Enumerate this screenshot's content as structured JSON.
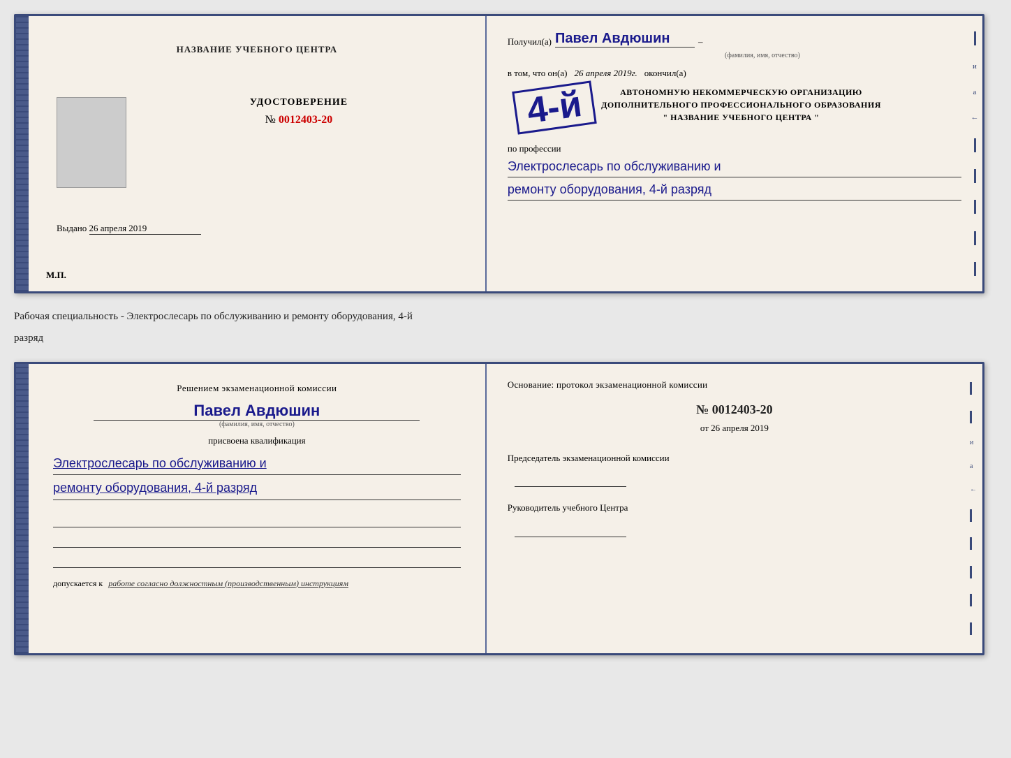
{
  "document_top": {
    "left": {
      "center_name": "НАЗВАНИЕ УЧЕБНОГО ЦЕНТРА",
      "cert_title": "УДОСТОВЕРЕНИЕ",
      "cert_number_prefix": "№",
      "cert_number": "0012403-20",
      "issued_label": "Выдано",
      "issued_date": "26 апреля 2019",
      "mp_label": "М.П."
    },
    "right": {
      "recipient_prefix": "Получил(а)",
      "recipient_name": "Павел Авдюшин",
      "fio_hint": "(фамилия, имя, отчество)",
      "vtom_prefix": "в том, что он(а)",
      "vtom_date": "26 апреля 2019г.",
      "okoncil": "окончил(а)",
      "grade_label": "4-й",
      "org_line1": "АВТОНОМНУЮ НЕКОММЕРЧЕСКУЮ ОРГАНИЗАЦИЮ",
      "org_line2": "ДОПОЛНИТЕЛЬНОГО ПРОФЕССИОНАЛЬНОГО ОБРАЗОВАНИЯ",
      "org_name": "\" НАЗВАНИЕ УЧЕБНОГО ЦЕНТРА \"",
      "po_professii": "по профессии",
      "profession_line1": "Электрослесарь по обслуживанию и",
      "profession_line2": "ремонту оборудования, 4-й разряд"
    }
  },
  "middle_text": {
    "line1": "Рабочая специальность - Электрослесарь по обслуживанию и ремонту оборудования, 4-й",
    "line2": "разряд"
  },
  "document_bottom": {
    "left": {
      "decision_text": "Решением экзаменационной комиссии",
      "person_name": "Павел Авдюшин",
      "fio_hint": "(фамилия, имя, отчество)",
      "qualification_label": "присвоена квалификация",
      "qualification_line1": "Электрослесарь по обслуживанию и",
      "qualification_line2": "ремонту оборудования, 4-й разряд",
      "допускается_prefix": "допускается к",
      "допускается_text": "работе согласно должностным (производственным) инструкциям"
    },
    "right": {
      "osnov_label": "Основание: протокол экзаменационной комиссии",
      "protocol_number_prefix": "№",
      "protocol_number": "0012403-20",
      "protocol_date_prefix": "от",
      "protocol_date": "26 апреля 2019",
      "chairman_label": "Председатель экзаменационной комиссии",
      "director_label": "Руководитель учебного Центра"
    }
  },
  "side_labels": {
    "и": "и",
    "а": "а",
    "arrow": "←",
    "dashes": [
      "–",
      "–",
      "–",
      "–",
      "–",
      "–",
      "–"
    ]
  }
}
